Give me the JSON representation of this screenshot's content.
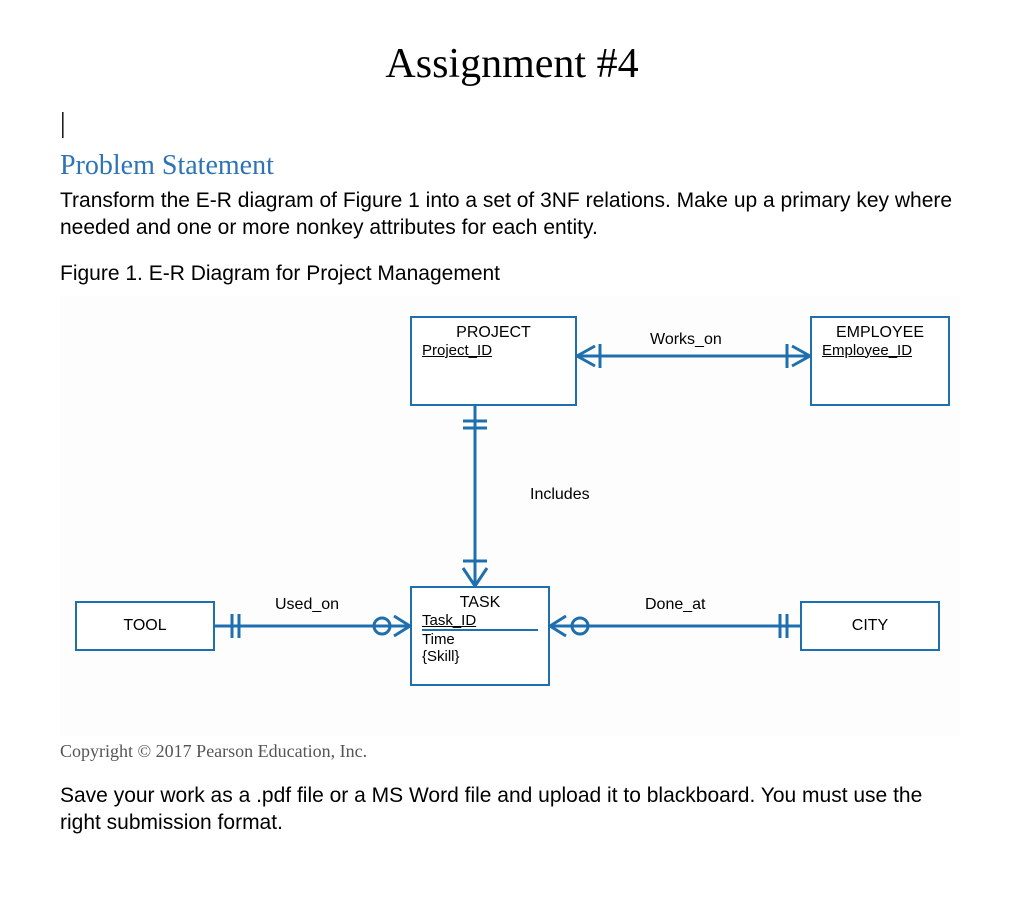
{
  "title": "Assignment #4",
  "cursor": "|",
  "section_heading": "Problem Statement",
  "problem_text_1": "Transform the E-R diagram of Figure 1 into a set of 3NF relations. Make up a primary key where needed and one or more ",
  "problem_text_spellerr": "nonkey",
  "problem_text_2": " attributes for each entity.",
  "figure_caption": "Figure 1. E-R Diagram for Project Management",
  "entities": {
    "project": {
      "name": "PROJECT",
      "pk": "Project_ID"
    },
    "employee": {
      "name": "EMPLOYEE",
      "pk": "Employee_ID"
    },
    "task": {
      "name": "TASK",
      "pk": "Task_ID",
      "attr1": "Time",
      "attr2": "{Skill}"
    },
    "tool": {
      "name": "TOOL"
    },
    "city": {
      "name": "CITY"
    }
  },
  "relationships": {
    "works_on": "Works_on",
    "includes": "Includes",
    "used_on": "Used_on",
    "done_at": "Done_at"
  },
  "copyright": "Copyright © 2017 Pearson Education, Inc.",
  "instructions": "Save your work as a .pdf file or a MS Word file and upload it to blackboard. You must use the right submission format.",
  "chart_data": {
    "type": "er-diagram",
    "title": "E-R Diagram for Project Management",
    "entities": [
      {
        "name": "PROJECT",
        "attributes": [
          {
            "name": "Project_ID",
            "pk": true
          }
        ]
      },
      {
        "name": "EMPLOYEE",
        "attributes": [
          {
            "name": "Employee_ID",
            "pk": true
          }
        ]
      },
      {
        "name": "TASK",
        "attributes": [
          {
            "name": "Task_ID",
            "pk": true
          },
          {
            "name": "Time"
          },
          {
            "name": "{Skill}",
            "multivalued": true
          }
        ]
      },
      {
        "name": "TOOL",
        "attributes": []
      },
      {
        "name": "CITY",
        "attributes": []
      }
    ],
    "relationships": [
      {
        "name": "Works_on",
        "from": "PROJECT",
        "to": "EMPLOYEE",
        "from_card": "one-or-more",
        "to_card": "one-or-more"
      },
      {
        "name": "Includes",
        "from": "PROJECT",
        "to": "TASK",
        "from_card": "exactly-one",
        "to_card": "one-or-more"
      },
      {
        "name": "Used_on",
        "from": "TOOL",
        "to": "TASK",
        "from_card": "exactly-one",
        "to_card": "zero-or-more"
      },
      {
        "name": "Done_at",
        "from": "TASK",
        "to": "CITY",
        "from_card": "zero-or-more",
        "to_card": "exactly-one"
      }
    ]
  }
}
